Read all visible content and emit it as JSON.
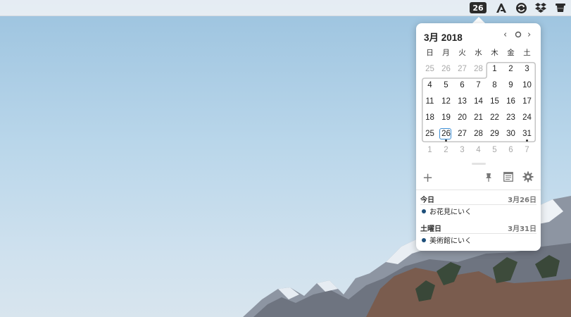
{
  "menubar": {
    "date_badge": "26",
    "icons": [
      "app-a-icon",
      "sync-icon",
      "dropbox-icon",
      "hat-icon"
    ]
  },
  "calendar": {
    "month_title": "3月 2018",
    "weekdays": [
      "日",
      "月",
      "火",
      "水",
      "木",
      "金",
      "土"
    ],
    "weeks": [
      [
        {
          "d": "25",
          "o": true
        },
        {
          "d": "26",
          "o": true
        },
        {
          "d": "27",
          "o": true
        },
        {
          "d": "28",
          "o": true
        },
        {
          "d": "1"
        },
        {
          "d": "2"
        },
        {
          "d": "3"
        }
      ],
      [
        {
          "d": "4"
        },
        {
          "d": "5"
        },
        {
          "d": "6"
        },
        {
          "d": "7"
        },
        {
          "d": "8"
        },
        {
          "d": "9"
        },
        {
          "d": "10"
        }
      ],
      [
        {
          "d": "11"
        },
        {
          "d": "12"
        },
        {
          "d": "13"
        },
        {
          "d": "14"
        },
        {
          "d": "15"
        },
        {
          "d": "16"
        },
        {
          "d": "17"
        }
      ],
      [
        {
          "d": "18"
        },
        {
          "d": "19"
        },
        {
          "d": "20"
        },
        {
          "d": "21"
        },
        {
          "d": "22"
        },
        {
          "d": "23"
        },
        {
          "d": "24"
        }
      ],
      [
        {
          "d": "25"
        },
        {
          "d": "26",
          "today": true,
          "dot": true
        },
        {
          "d": "27"
        },
        {
          "d": "28"
        },
        {
          "d": "29"
        },
        {
          "d": "30"
        },
        {
          "d": "31",
          "dot": true
        }
      ],
      [
        {
          "d": "1",
          "o": true
        },
        {
          "d": "2",
          "o": true
        },
        {
          "d": "3",
          "o": true
        },
        {
          "d": "4",
          "o": true
        },
        {
          "d": "5",
          "o": true
        },
        {
          "d": "6",
          "o": true
        },
        {
          "d": "7",
          "o": true
        }
      ]
    ],
    "today_color": "#3d8fd6"
  },
  "events": [
    {
      "header": "今日",
      "date": "3月26日",
      "title": "お花見にいく"
    },
    {
      "header": "土曜日",
      "date": "3月31日",
      "title": "美術館にいく"
    }
  ],
  "event_dot_color": "#1e4f7a"
}
